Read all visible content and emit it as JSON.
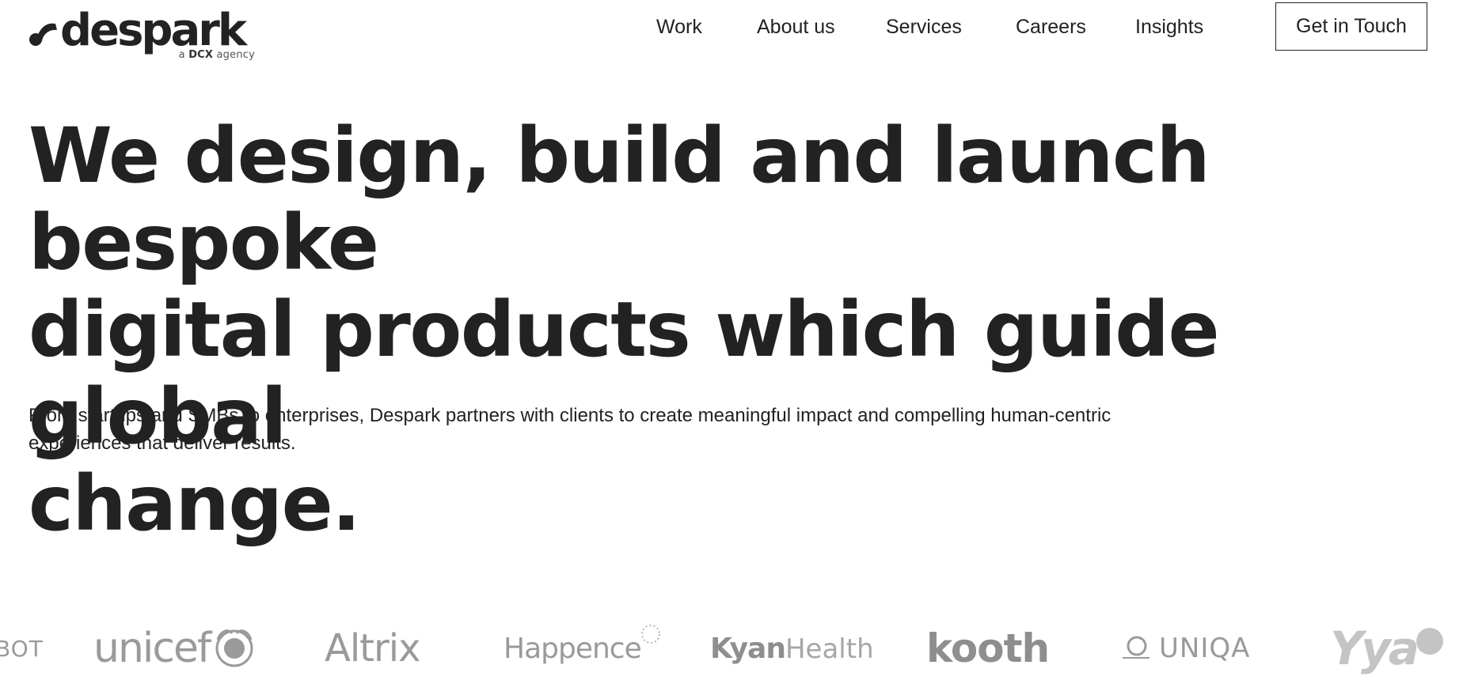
{
  "brand": {
    "name": "despark",
    "tagline_prefix": "a",
    "tagline_strong": "DCX",
    "tagline_suffix": "agency"
  },
  "nav": {
    "items": [
      {
        "label": "Work"
      },
      {
        "label": "About us"
      },
      {
        "label": "Services"
      },
      {
        "label": "Careers"
      },
      {
        "label": "Insights"
      }
    ],
    "cta_label": "Get in Touch"
  },
  "hero": {
    "title_lines": [
      "We design, build and launch bespoke",
      "digital products which guide global",
      "change."
    ],
    "subtitle_lines": [
      "From startups and SMBs to enterprises, Despark partners with clients to create meaningful impact and compelling human-centric",
      "experiences that deliver results."
    ]
  },
  "clients": {
    "logos": [
      {
        "name": "BOT",
        "text": "BOT"
      },
      {
        "name": "unicef",
        "text": "unicef"
      },
      {
        "name": "Altrix",
        "text": "Altrix"
      },
      {
        "name": "Happence",
        "text": "Happence"
      },
      {
        "name": "KyanHealth",
        "text_bold": "Kyan",
        "text_light": "Health"
      },
      {
        "name": "kooth",
        "text": "kooth"
      },
      {
        "name": "UNIQA",
        "text": "UNIQA"
      },
      {
        "name": "Yya",
        "text": "Yya"
      }
    ]
  },
  "colors": {
    "text": "#222222",
    "background": "#ffffff",
    "logo_gray": "#9a9a9a"
  }
}
